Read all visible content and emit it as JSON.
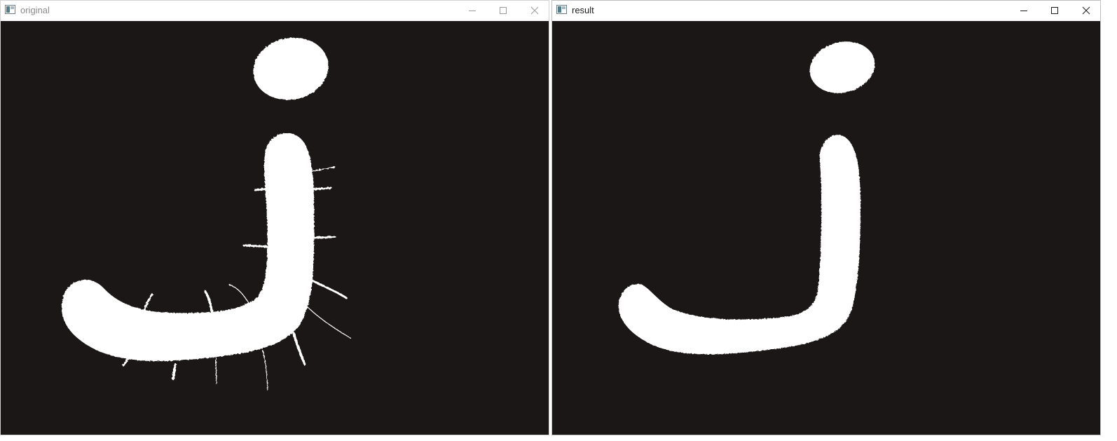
{
  "windows": {
    "original": {
      "title": "original",
      "icons": {
        "app": "app-window-icon",
        "minimize": "minimize-icon",
        "maximize": "maximize-icon",
        "close": "close-icon"
      }
    },
    "result": {
      "title": "result",
      "icons": {
        "app": "app-window-icon",
        "minimize": "minimize-icon",
        "maximize": "maximize-icon",
        "close": "close-icon"
      }
    }
  },
  "colors": {
    "canvas_background": "#1c1717",
    "glyph": "#ffffff",
    "titlebar": "#ffffff",
    "inactive_title_text": "#8a8a8a",
    "active_title_text": "#1a1a1a"
  }
}
